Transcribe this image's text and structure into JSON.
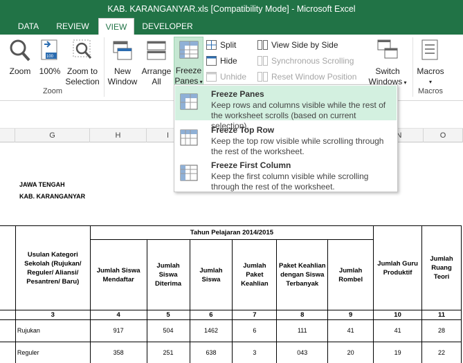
{
  "window": {
    "title": "KAB. KARANGANYAR.xls  [Compatibility Mode] - Microsoft Excel"
  },
  "tabs": [
    {
      "label": "DATA",
      "active": false
    },
    {
      "label": "REVIEW",
      "active": false
    },
    {
      "label": "VIEW",
      "active": true
    },
    {
      "label": "DEVELOPER",
      "active": false
    }
  ],
  "ribbon": {
    "zoom_btn": "Zoom",
    "hundred_btn": "100%",
    "zoom_selection_l1": "Zoom to",
    "zoom_selection_l2": "Selection",
    "zoom_group": "Zoom",
    "new_window_l1": "New",
    "new_window_l2": "Window",
    "arrange_all_l1": "Arrange",
    "arrange_all_l2": "All",
    "freeze_panes_l1": "Freeze",
    "freeze_panes_l2": "Panes",
    "split": "Split",
    "hide": "Hide",
    "unhide": "Unhide",
    "view_side_by_side": "View Side by Side",
    "synchronous_scrolling": "Synchronous Scrolling",
    "reset_window_position": "Reset Window Position",
    "switch_windows_l1": "Switch",
    "switch_windows_l2": "Windows",
    "macros": "Macros",
    "macros_group": "Macros"
  },
  "dropdown": {
    "items": [
      {
        "title": "Freeze Panes",
        "description": "Keep rows and columns visible while the rest of the worksheet scrolls (based on current selection)."
      },
      {
        "title": "Freeze Top Row",
        "description": "Keep the top row visible while scrolling through the rest of the worksheet."
      },
      {
        "title": "Freeze First Column",
        "description": "Keep the first column visible while scrolling through the rest of the worksheet."
      }
    ]
  },
  "columns": [
    "G",
    "H",
    "I",
    "N",
    "O"
  ],
  "sheet": {
    "province": "JAWA TENGAH",
    "regency": "KAB. KARANGANYAR",
    "year_header": "Tahun Pelajaran 2014/2015",
    "headers": {
      "category": "Usulan Kategori Sekolah (Rujukan/ Reguler/ Aliansi/ Pesantren/ Baru)",
      "registered": "Jumlah Siswa Mendaftar",
      "accepted": "Jumlah Siswa Diterima",
      "students": "Jumlah Siswa",
      "packages": "Jumlah Paket Keahlian",
      "top_package": "Paket Keahlian dengan Siswa Terbanyak",
      "groups": "Jumlah Rombel",
      "teachers": "Jumlah Guru Produktif",
      "rooms": "Jumlah Ruang Teori"
    },
    "col_numbers": [
      "3",
      "4",
      "5",
      "6",
      "7",
      "8",
      "9",
      "10",
      "11"
    ],
    "rows": [
      {
        "category": "Rujukan",
        "values": [
          "917",
          "504",
          "1462",
          "6",
          "111",
          "41",
          "41",
          "28"
        ]
      },
      {
        "category": "Reguler",
        "values": [
          "358",
          "251",
          "638",
          "3",
          "043",
          "20",
          "19",
          "22"
        ]
      }
    ]
  }
}
